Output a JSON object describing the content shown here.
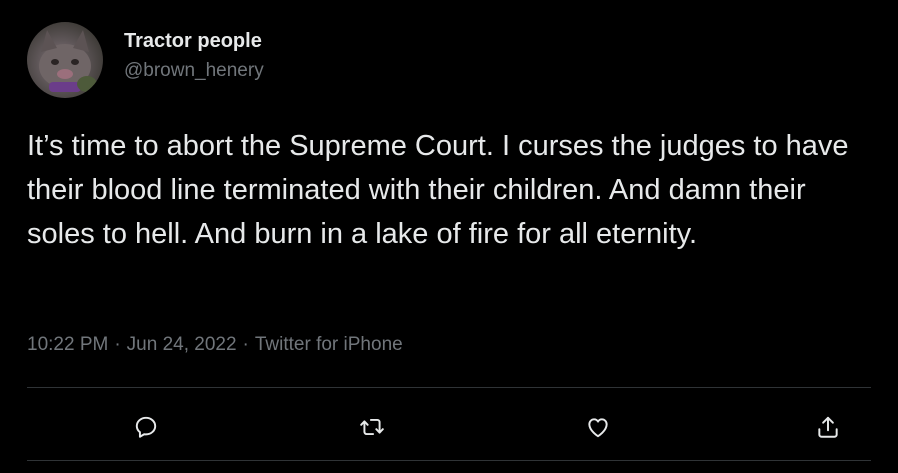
{
  "tweet": {
    "display_name": "Tractor people",
    "handle": "@brown_henery",
    "text": "It’s time to abort the Supreme Court. I curses the judges to have their blood line terminated with their children. And damn their soles to hell. And burn in a lake of fire for all eternity.",
    "time": "10:22 PM",
    "separator": "·",
    "date": "Jun 24, 2022",
    "source": "Twitter for iPhone"
  },
  "actions": {
    "reply_icon": "reply-icon",
    "retweet_icon": "retweet-icon",
    "like_icon": "heart-icon",
    "share_icon": "share-icon"
  },
  "colors": {
    "background": "#000000",
    "primary_text": "#e7e9ea",
    "secondary_text": "#71767b",
    "divider": "#2f3336"
  }
}
